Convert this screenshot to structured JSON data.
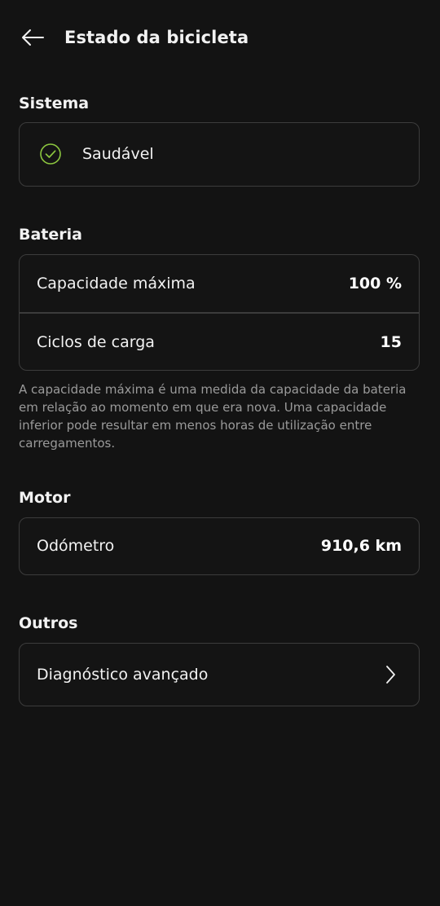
{
  "header": {
    "title": "Estado da bicicleta",
    "back_icon": "arrow-left-icon"
  },
  "sistema": {
    "section_title": "Sistema",
    "status_label": "Saudável",
    "status_icon": "check-circle-icon",
    "status_color": "#8cc63f"
  },
  "bateria": {
    "section_title": "Bateria",
    "rows": [
      {
        "label": "Capacidade máxima",
        "value": "100 %"
      },
      {
        "label": "Ciclos de carga",
        "value": "15"
      }
    ],
    "note": "A capacidade máxima é uma medida da capacidade da bateria em relação ao momento em que era nova. Uma capacidade inferior pode resultar em menos horas de utilização entre carregamentos."
  },
  "motor": {
    "section_title": "Motor",
    "rows": [
      {
        "label": "Odómetro",
        "value": "910,6 km"
      }
    ]
  },
  "outros": {
    "section_title": "Outros",
    "rows": [
      {
        "label": "Diagnóstico avançado",
        "icon": "chevron-right-icon"
      }
    ]
  }
}
